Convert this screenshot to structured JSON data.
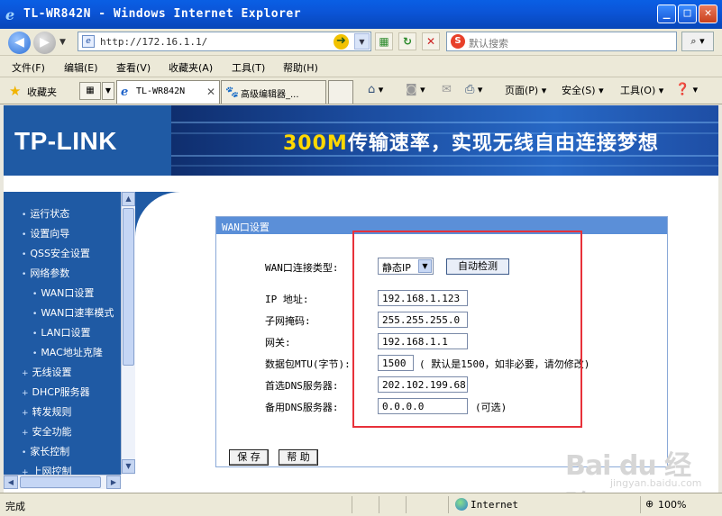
{
  "window": {
    "title": "TL-WR842N - Windows Internet Explorer",
    "minimize": "_",
    "maximize": "□",
    "close": "✕"
  },
  "address_bar": {
    "url": "http://172.16.1.1/",
    "search_placeholder": "默认搜索"
  },
  "menu": [
    "文件(F)",
    "编辑(E)",
    "查看(V)",
    "收藏夹(A)",
    "工具(T)",
    "帮助(H)"
  ],
  "tabs": {
    "favorites_label": "收藏夹",
    "items": [
      {
        "label": "TL-WR842N"
      },
      {
        "label": "高级编辑器_..."
      }
    ],
    "commands": {
      "page": "页面(P)",
      "safety": "安全(S)",
      "tools": "工具(O)"
    }
  },
  "banner": {
    "logo": "TP-LINK",
    "slogan_highlight": "300M",
    "slogan_rest": "传输速率，实现无线自由连接梦想"
  },
  "sidebar": {
    "items": [
      {
        "label": "运行状态",
        "bullet": "•"
      },
      {
        "label": "设置向导",
        "bullet": "•"
      },
      {
        "label": "QSS安全设置",
        "bullet": "•"
      },
      {
        "label": "网络参数",
        "bullet": "•"
      },
      {
        "label": "WAN口设置",
        "bullet": "•"
      },
      {
        "label": "WAN口速率模式",
        "bullet": "•"
      },
      {
        "label": "LAN口设置",
        "bullet": "•"
      },
      {
        "label": "MAC地址克隆",
        "bullet": "•"
      },
      {
        "label": "无线设置",
        "bullet": "+"
      },
      {
        "label": "DHCP服务器",
        "bullet": "+"
      },
      {
        "label": "转发规则",
        "bullet": "+"
      },
      {
        "label": "安全功能",
        "bullet": "+"
      },
      {
        "label": "家长控制",
        "bullet": "•"
      },
      {
        "label": "上网控制",
        "bullet": "+"
      }
    ]
  },
  "wan": {
    "header": "WAN口设置",
    "conn_type_label": "WAN口连接类型:",
    "conn_type_value": "静态IP",
    "auto_detect": "自动检测",
    "ip_label": "IP 地址:",
    "ip_value": "192.168.1.123",
    "mask_label": "子网掩码:",
    "mask_value": "255.255.255.0",
    "gateway_label": "网关:",
    "gateway_value": "192.168.1.1",
    "mtu_label": "数据包MTU(字节):",
    "mtu_value": "1500",
    "mtu_hint": "( 默认是1500，如非必要，请勿修改)",
    "dns1_label": "首选DNS服务器:",
    "dns1_value": "202.102.199.68",
    "dns2_label": "备用DNS服务器:",
    "dns2_value": "0.0.0.0",
    "dns2_hint": "(可选)",
    "save": "保 存",
    "help": "帮 助"
  },
  "watermark": {
    "logo": "Bai du 经验",
    "sub": "jingyan.baidu.com"
  },
  "status": {
    "text": "完成",
    "zone": "Internet",
    "zoom": "100%"
  },
  "colors": {
    "brand_blue": "#1f5aa4",
    "highlight_red": "#e8313a",
    "slogan_yellow": "#ffd800"
  }
}
